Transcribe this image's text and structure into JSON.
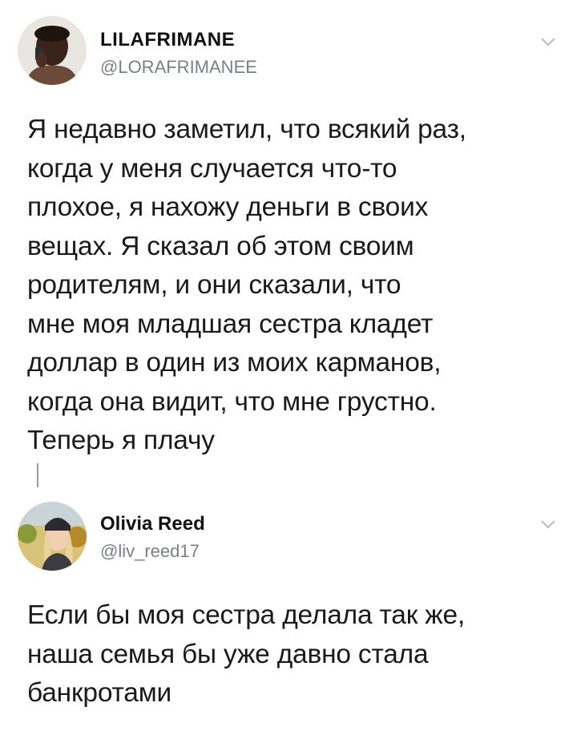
{
  "tweets": [
    {
      "display_name": "LILAFRIMANE",
      "handle": "@LORAFRIMANEE",
      "text": "Я недавно заметил, что всякий раз,\nкогда у меня случается что-то\nплохое, я нахожу деньги в своих\nвещах. Я сказал об этом своим\nродителям, и они сказали, что\nмне моя младшая сестра кладет\nдоллар в один из моих карманов,\nкогда она видит, что мне грустно.\nТеперь я плачу",
      "icons": {
        "avatar": "user-avatar",
        "menu": "chevron-down-icon"
      }
    },
    {
      "display_name": "Olivia Reed",
      "handle": "@liv_reed17",
      "text": "Если бы моя сестра делала так же,\nнаша семья бы уже давно стала\nбанкротами",
      "icons": {
        "avatar": "user-avatar",
        "menu": "chevron-down-icon"
      }
    }
  ],
  "colors": {
    "text": "#1a1a1a",
    "handle": "#7a7f85",
    "chevron": "#b8bcc0"
  }
}
